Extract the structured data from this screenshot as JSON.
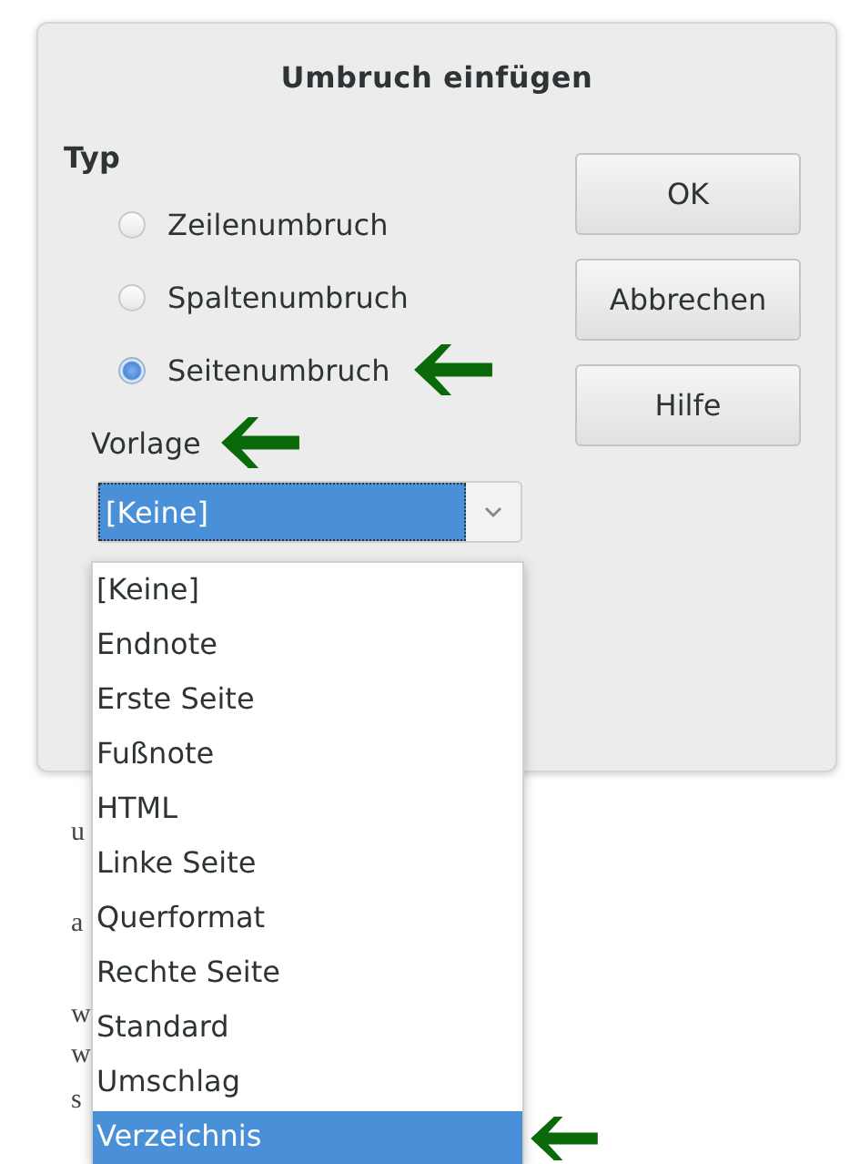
{
  "dialog": {
    "title": "Umbruch einfügen"
  },
  "type_group": {
    "label": "Typ",
    "options": [
      {
        "label": "Zeilenumbruch",
        "selected": false,
        "arrow": false
      },
      {
        "label": "Spaltenumbruch",
        "selected": false,
        "arrow": false
      },
      {
        "label": "Seitenumbruch",
        "selected": true,
        "arrow": true
      }
    ]
  },
  "template": {
    "label": "Vorlage",
    "arrow": true,
    "value": "[Keine]"
  },
  "buttons": [
    {
      "label": "OK"
    },
    {
      "label": "Abbrechen"
    },
    {
      "label": "Hilfe"
    }
  ],
  "dropdown": {
    "items": [
      {
        "label": "[Keine]",
        "selected": false,
        "arrow": false
      },
      {
        "label": "Endnote",
        "selected": false,
        "arrow": false
      },
      {
        "label": "Erste Seite",
        "selected": false,
        "arrow": false
      },
      {
        "label": "Fußnote",
        "selected": false,
        "arrow": false
      },
      {
        "label": "HTML",
        "selected": false,
        "arrow": false
      },
      {
        "label": "Linke Seite",
        "selected": false,
        "arrow": false
      },
      {
        "label": "Querformat",
        "selected": false,
        "arrow": false
      },
      {
        "label": "Rechte Seite",
        "selected": false,
        "arrow": false
      },
      {
        "label": "Standard",
        "selected": false,
        "arrow": false
      },
      {
        "label": "Umschlag",
        "selected": false,
        "arrow": false
      },
      {
        "label": "Verzeichnis",
        "selected": true,
        "arrow": true
      }
    ]
  },
  "document_fragments": [
    "u",
    "a",
    "w",
    "w",
    "s"
  ]
}
